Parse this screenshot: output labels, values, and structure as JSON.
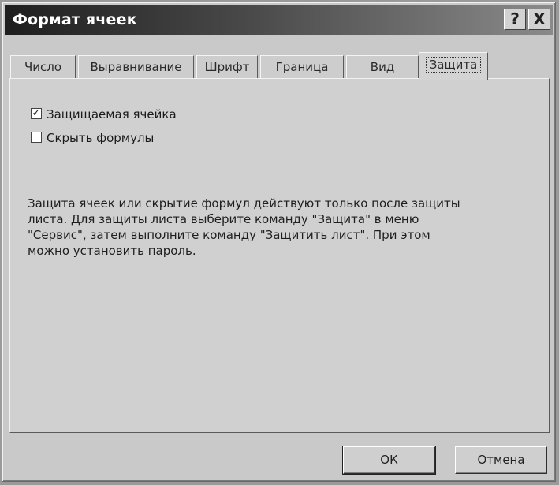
{
  "window": {
    "title": "Формат ячеек",
    "help_glyph": "?",
    "close_glyph": "X"
  },
  "tabs": [
    {
      "label": "Число"
    },
    {
      "label": "Выравнивание"
    },
    {
      "label": "Шрифт"
    },
    {
      "label": "Граница"
    },
    {
      "label": "Вид"
    },
    {
      "label": "Защита",
      "active": true
    }
  ],
  "options": {
    "locked": {
      "label": "Защищаемая ячейка",
      "checked": true,
      "mark": "✓"
    },
    "hidden": {
      "label": "Скрыть формулы",
      "checked": false,
      "mark": ""
    }
  },
  "description": "Защита ячеек или скрытие формул действуют только после защиты листа. Для защиты листа выберите команду \"Защита\" в меню \"Сервис\", затем выполните команду \"Защитить лист\". При этом можно установить пароль.",
  "buttons": {
    "ok": "ОК",
    "cancel": "Отмена"
  }
}
